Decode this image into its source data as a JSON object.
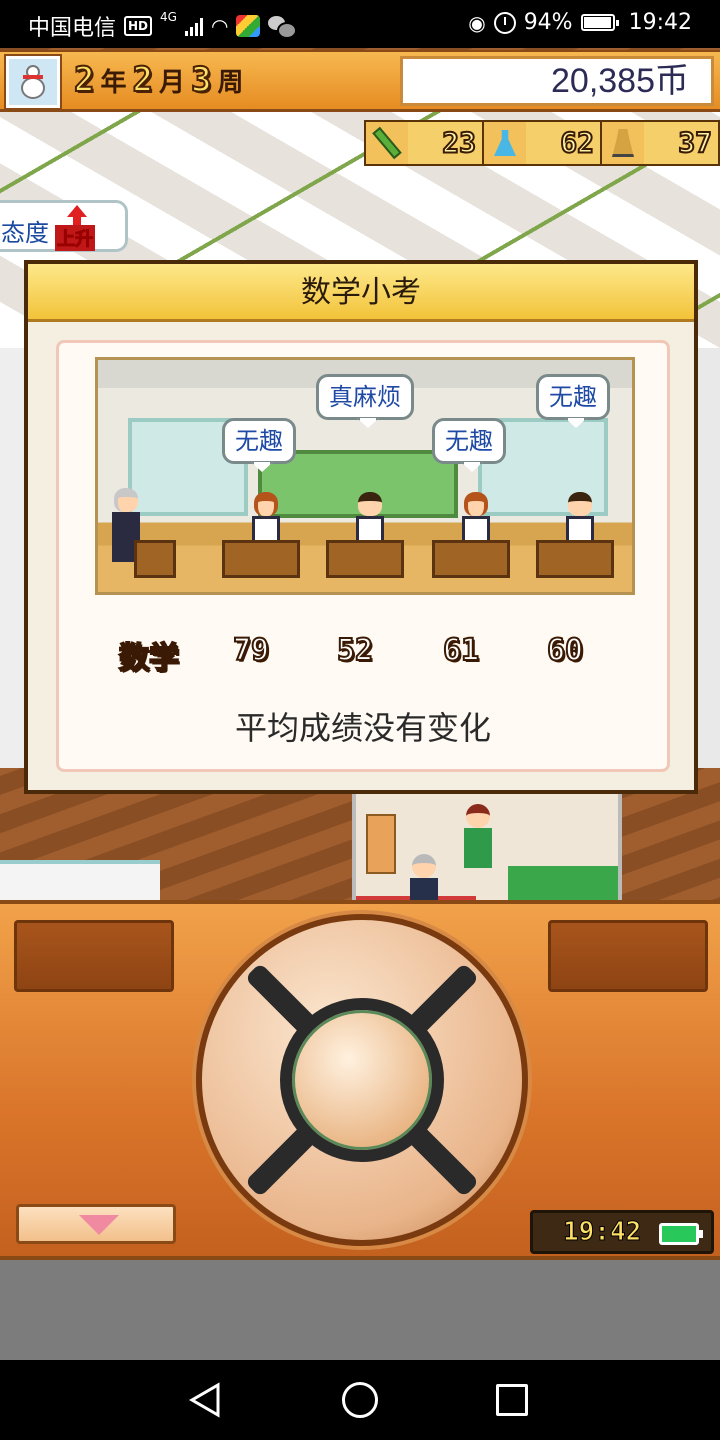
{
  "status_bar": {
    "carrier": "中国电信",
    "network": "4G",
    "battery_percent": "94%",
    "time": "19:42"
  },
  "header": {
    "year_num": "2",
    "year_unit": "年",
    "month_num": "2",
    "month_unit": "月",
    "week_num": "3",
    "week_unit": "周",
    "money": "20,385币"
  },
  "resources": [
    {
      "icon": "pencil-icon",
      "value": "23"
    },
    {
      "icon": "flask-icon",
      "value": "62"
    },
    {
      "icon": "tower-icon",
      "value": "37"
    }
  ],
  "attitude": {
    "label": "态度",
    "change": "上升"
  },
  "dialog": {
    "title": "数学小考",
    "bubbles": [
      "无趣",
      "真麻烦",
      "无趣",
      "无趣"
    ],
    "subject": "数学",
    "scores": [
      "79",
      "52",
      "61",
      "60"
    ],
    "result": "平均成绩没有变化"
  },
  "controller": {
    "clock": "19:42"
  }
}
